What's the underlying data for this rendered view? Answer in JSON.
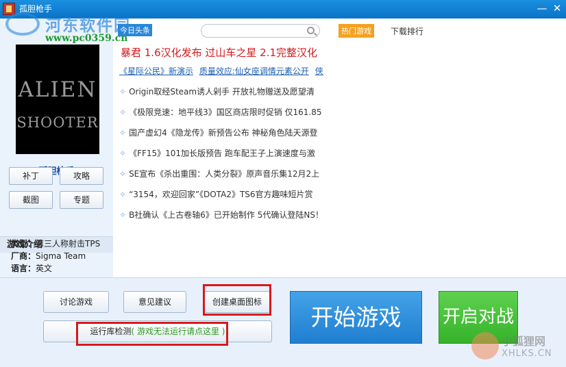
{
  "window": {
    "title": "孤胆枪手",
    "minimize": "—",
    "close": "✕"
  },
  "watermark_top": {
    "brand": "河东软件园",
    "url": "www.pc0359.cn"
  },
  "game": {
    "cover_line1": "ALIEN",
    "cover_line2": "SHOOTER",
    "name": "孤胆枪手",
    "buttons": {
      "patch": "补丁",
      "guide": "攻略",
      "screenshot": "截图",
      "topic": "专题"
    }
  },
  "intro": {
    "title": "游戏介绍",
    "type_label": "类型：",
    "type_value": "第三人称射击TPS",
    "vendor_label": "厂商：",
    "vendor_value": "Sigma Team",
    "lang_label": "语言：",
    "lang_value": "英文"
  },
  "news": {
    "tag": "今日头条",
    "search_placeholder": "",
    "headline": "暴君 1.6汉化发布  过山车之星 2.1完整汉化",
    "sublinks": [
      "《星际公民》新演示",
      "质量效应:仙女座调情元素公开",
      "侠"
    ],
    "bullet": "✧",
    "items": [
      "Origin取经Steam诱人剁手 开放礼物赠送及愿望清",
      "《极限竞速：地平线3》国区商店限时促销 仅161.85",
      "国产虚幻4《隐龙传》新预告公布 神秘角色陆天源登",
      "《FF15》101加长版预告 跑车配王子上演速度与激",
      "SE宣布《杀出重围：人类分裂》原声音乐集12月2上",
      "“3154，欢迎回家”《DOTA2》TS6官方趣味短片赏",
      "B社确认《上古卷轴6》已开始制作 5代确认登陆NS！"
    ]
  },
  "tabs": {
    "hot": "热门游戏",
    "rank": "下载排行"
  },
  "bottom": {
    "discuss": "讨论游戏",
    "feedback": "意见建议",
    "create_shortcut": "创建桌面图标",
    "runtime_check": "运行库检测",
    "runtime_hint": "( 游戏无法运行请点这里 )",
    "start": "开始游戏",
    "battle": "开启对战"
  },
  "watermark_bottom": {
    "brand": "小狐狸网",
    "url": "XHLKS.CN"
  },
  "colors": {
    "titlebar": "#0a74c7",
    "start_button": "#2b8ddc",
    "battle_button": "#44c034",
    "headline_red": "#d2191b",
    "hot_tab": "#f4a11f",
    "highlight_frame": "#d7191c"
  }
}
